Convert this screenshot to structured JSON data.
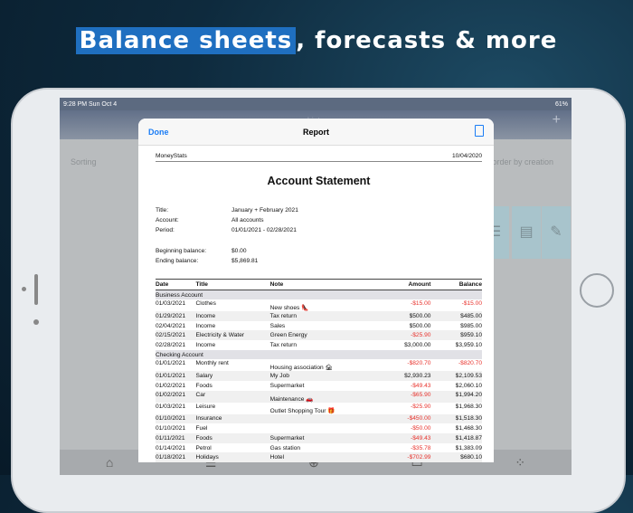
{
  "headline": {
    "highlight": "Balance sheets",
    "rest": ", forecasts & more"
  },
  "status": {
    "time": "9:28 PM  Sun Oct 4",
    "battery": "61%"
  },
  "background_app": {
    "title": "Lists",
    "sorting": "Sorting",
    "order": "order by creation"
  },
  "modal": {
    "done": "Done",
    "title": "Report"
  },
  "doc": {
    "app": "MoneyStats",
    "date": "10/04/2020",
    "title": "Account Statement",
    "info": [
      {
        "k": "Title:",
        "v": "January + February 2021"
      },
      {
        "k": "Account:",
        "v": "All accounts"
      },
      {
        "k": "Period:",
        "v": "01/01/2021 - 02/28/2021"
      }
    ],
    "balances": [
      {
        "k": "Beginning balance:",
        "v": "$0.00"
      },
      {
        "k": "Ending balance:",
        "v": "$5,869.81"
      }
    ],
    "columns": [
      "Date",
      "Title",
      "Note",
      "Amount",
      "Balance"
    ],
    "groups": [
      {
        "name": "Business Account",
        "rows": [
          [
            "01/03/2021",
            "Clothes",
            "New shoes 👠",
            "-$15.00",
            "-$15.00"
          ],
          [
            "01/29/2021",
            "Income",
            "Tax return",
            "$500.00",
            "$485.00"
          ],
          [
            "02/04/2021",
            "Income",
            "Sales",
            "$500.00",
            "$985.00"
          ],
          [
            "02/15/2021",
            "Electricity & Water",
            "Green Energy",
            "-$25.90",
            "$959.10"
          ],
          [
            "02/28/2021",
            "Income",
            "Tax return",
            "$3,000.00",
            "$3,959.10"
          ]
        ]
      },
      {
        "name": "Checking Account",
        "rows": [
          [
            "01/01/2021",
            "Monthly rent",
            "Housing association 🏚",
            "-$820.70",
            "-$820.70"
          ],
          [
            "01/01/2021",
            "Salary",
            "My Job",
            "$2,930.23",
            "$2,109.53"
          ],
          [
            "01/02/2021",
            "Foods",
            "Supermarket",
            "-$49.43",
            "$2,060.10"
          ],
          [
            "01/02/2021",
            "Car",
            "Maintenance 🚗",
            "-$65.90",
            "$1,994.20"
          ],
          [
            "01/03/2021",
            "Leisure",
            "Outlet Shopping Tour 🎁",
            "-$25.90",
            "$1,968.30"
          ],
          [
            "01/10/2021",
            "Insurance",
            "",
            "-$450.00",
            "$1,518.30"
          ],
          [
            "01/10/2021",
            "Fuel",
            "",
            "-$50.00",
            "$1,468.30"
          ],
          [
            "01/11/2021",
            "Foods",
            "Supermarket",
            "-$49.43",
            "$1,418.87"
          ],
          [
            "01/14/2021",
            "Petrol",
            "Gas station",
            "-$35.78",
            "$1,383.09"
          ],
          [
            "01/18/2021",
            "Holidays",
            "Hotel",
            "-$702.99",
            "$680.10"
          ]
        ]
      }
    ]
  }
}
